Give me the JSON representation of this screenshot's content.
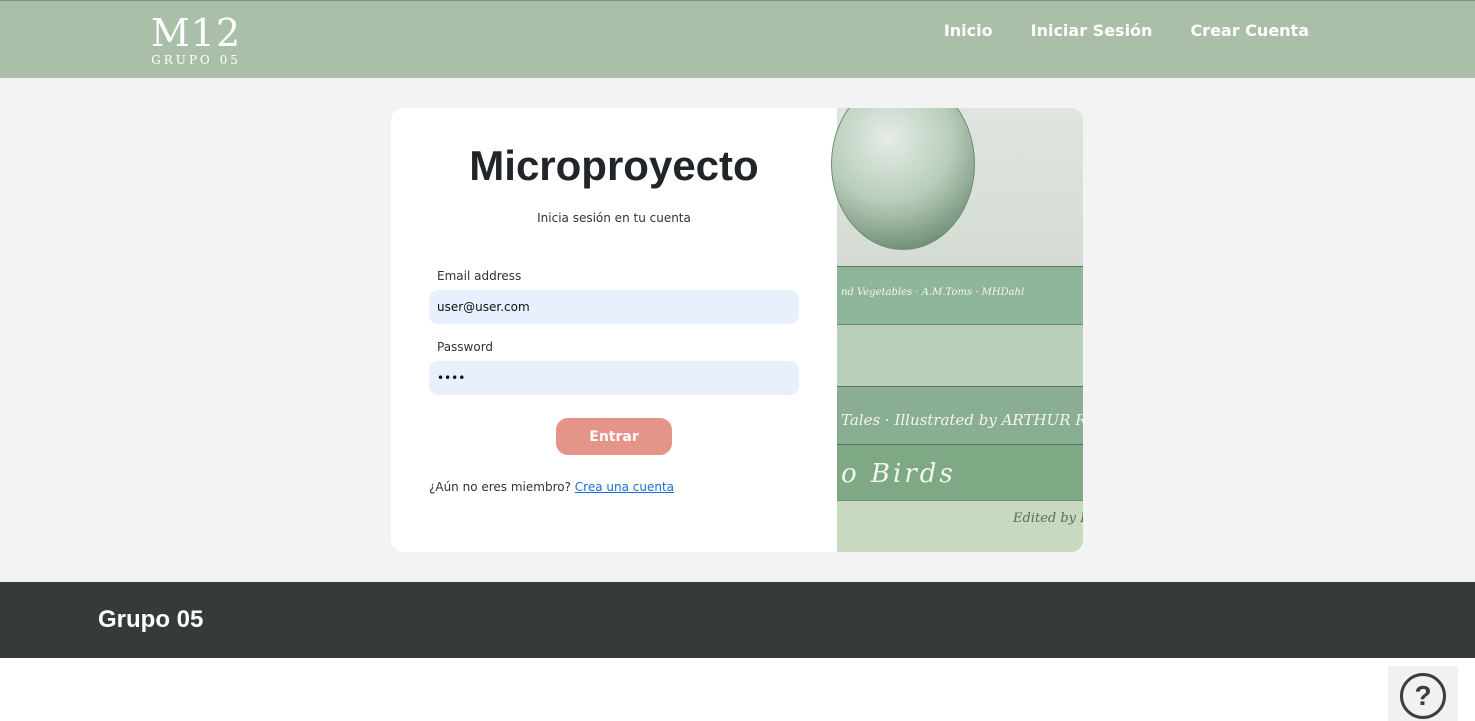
{
  "brand": {
    "title": "M12",
    "subtitle": "GRUPO 05"
  },
  "nav": {
    "items": [
      {
        "label": "Inicio"
      },
      {
        "label": "Iniciar Sesión"
      },
      {
        "label": "Crear Cuenta"
      }
    ]
  },
  "login": {
    "title": "Microproyecto",
    "subtitle": "Inicia sesión en tu cuenta",
    "email_label": "Email address",
    "email_value": "user@user.com",
    "password_label": "Password",
    "password_value": "user",
    "submit_label": "Entrar",
    "signup_prompt": "¿Aún no eres miembro?",
    "signup_link": "Crea una cuenta"
  },
  "footer": {
    "title": "Grupo 05"
  },
  "help": {
    "symbol": "?",
    "icon": "help-icon"
  },
  "colors": {
    "navbar": "#aabfa8",
    "button": "#e49587",
    "footer": "#363b37",
    "input_bg": "#e8f0fe",
    "link": "#1a6fd6"
  }
}
